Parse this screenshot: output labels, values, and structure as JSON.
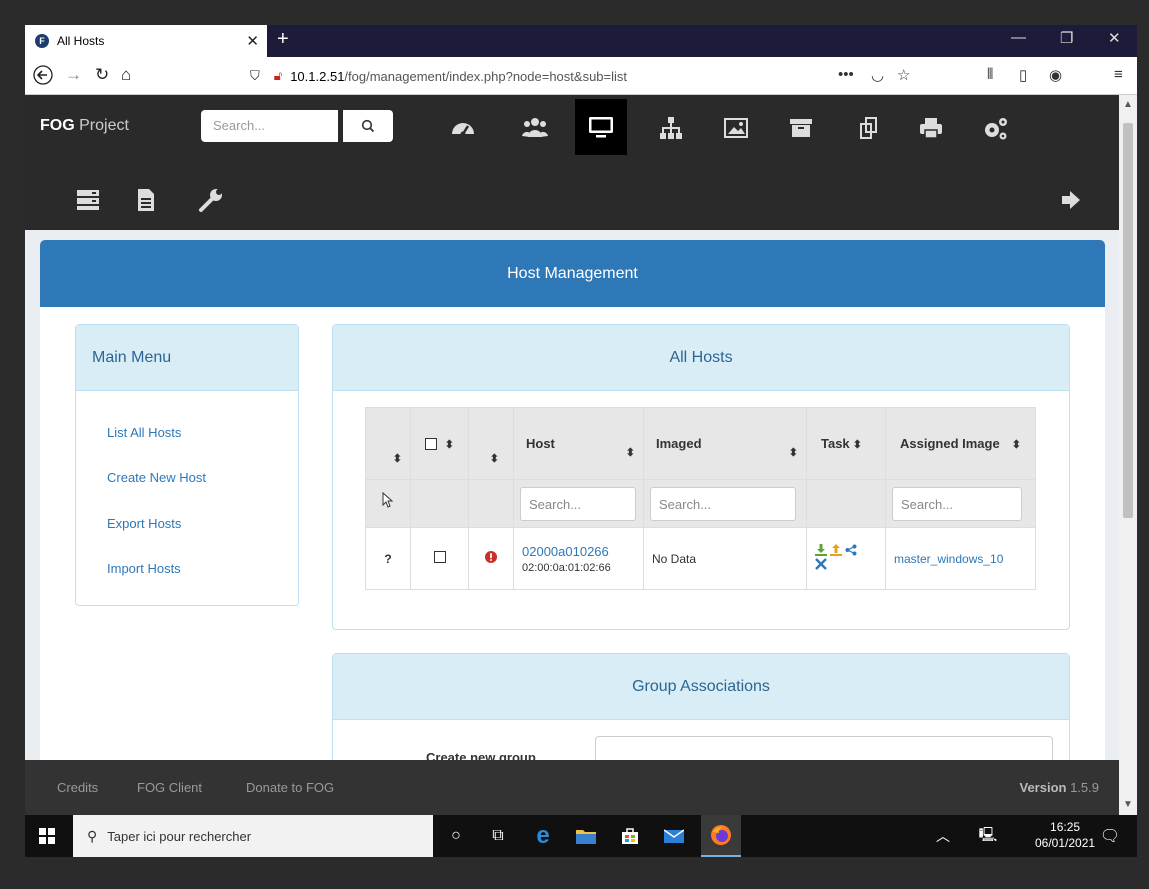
{
  "browser": {
    "tab_title": "All Hosts",
    "tab_favicon_letter": "F",
    "url_host": "10.1.2.51",
    "url_path": "/fog/management/index.php?node=host&sub=list"
  },
  "header": {
    "brand_bold": "FOG",
    "brand_rest": " Project",
    "search_placeholder": "Search...",
    "icons": [
      "dashboard-icon",
      "users-icon",
      "hosts-monitor-icon",
      "groups-sitemap-icon",
      "images-icon",
      "storage-archive-icon",
      "snapins-icon",
      "printers-icon",
      "settings-cogs-icon",
      "tasks-server-icon",
      "reports-document-icon",
      "plugins-wrench-icon",
      "logout-icon"
    ]
  },
  "page": {
    "title": "Host Management"
  },
  "main_menu": {
    "title": "Main Menu",
    "items": [
      "List All Hosts",
      "Create New Host",
      "Export Hosts",
      "Import Hosts"
    ]
  },
  "all_hosts": {
    "title": "All Hosts",
    "columns": [
      "Host",
      "Imaged",
      "Task",
      "Assigned Image"
    ],
    "filter_placeholder": "Search...",
    "rows": [
      {
        "status": "?",
        "host": "02000a010266",
        "mac": "02:00:0a:01:02:66",
        "imaged": "No Data",
        "assigned_image": "master_windows_10"
      }
    ]
  },
  "group_associations": {
    "title": "Group Associations",
    "create_label": "Create new group"
  },
  "footer": {
    "links": [
      "Credits",
      "FOG Client",
      "Donate to FOG"
    ],
    "version_label": "Version",
    "version_number": "1.5.9"
  },
  "taskbar": {
    "search_placeholder": "Taper ici pour rechercher",
    "time": "16:25",
    "date": "06/01/2021"
  },
  "colors": {
    "accent": "#2e78b8",
    "header_bg": "#2a2a2a",
    "panel_head": "#d9edf7",
    "error": "#c9302c"
  }
}
